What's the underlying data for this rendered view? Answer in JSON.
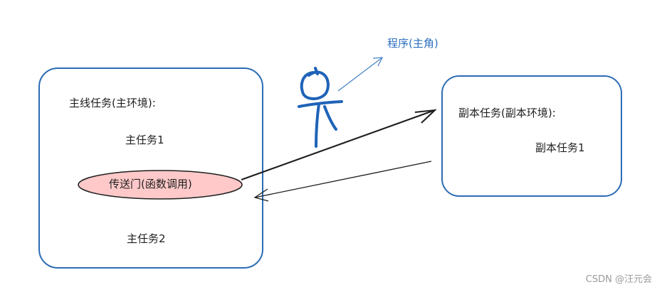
{
  "main_box": {
    "title": "主线任务(主环境):",
    "task1": "主任务1",
    "portal": "传送门(函数调用)",
    "task2": "主任务2"
  },
  "side_box": {
    "title": "副本任务(副本环境):",
    "task1": "副本任务1"
  },
  "protagonist_label": "程序(主角)",
  "watermark": "CSDN @汪元会",
  "colors": {
    "box_stroke": "#2b6cb5",
    "portal_fill": "#ffc9c9",
    "label_blue": "#2c6fbf",
    "arrow_dark": "#1e1e1e"
  }
}
